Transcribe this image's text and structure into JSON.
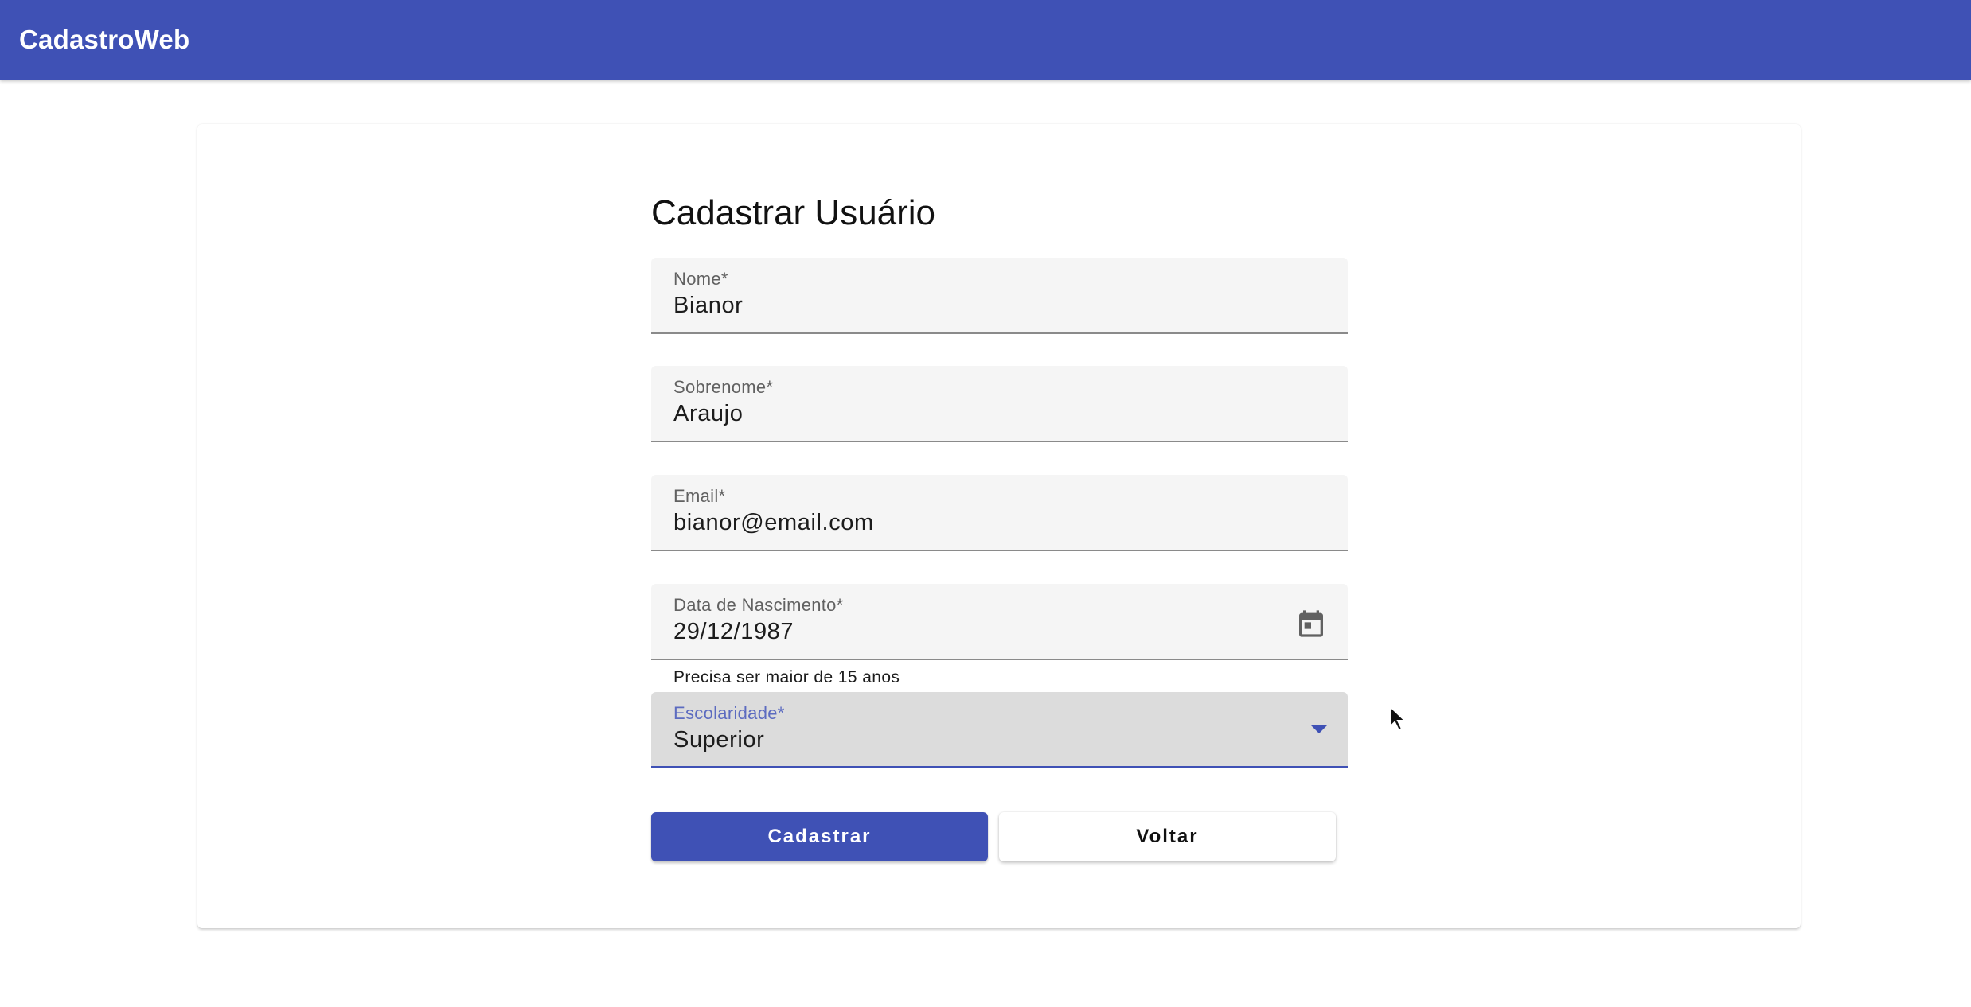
{
  "app": {
    "title": "CadastroWeb",
    "accent_color": "#3f51b5"
  },
  "form": {
    "title": "Cadastrar Usuário",
    "fields": {
      "nome": {
        "label": "Nome*",
        "value": "Bianor"
      },
      "sobrenome": {
        "label": "Sobrenome*",
        "value": "Araujo"
      },
      "email": {
        "label": "Email*",
        "value": "bianor@email.com"
      },
      "nascimento": {
        "label": "Data de Nascimento*",
        "value": "29/12/1987",
        "hint": "Precisa ser maior de 15 anos",
        "icon": "calendar-icon"
      },
      "escolaridade": {
        "label": "Escolaridade*",
        "value": "Superior",
        "icon": "dropdown-arrow-icon"
      }
    },
    "buttons": {
      "submit_label": "Cadastrar",
      "back_label": "Voltar"
    }
  }
}
